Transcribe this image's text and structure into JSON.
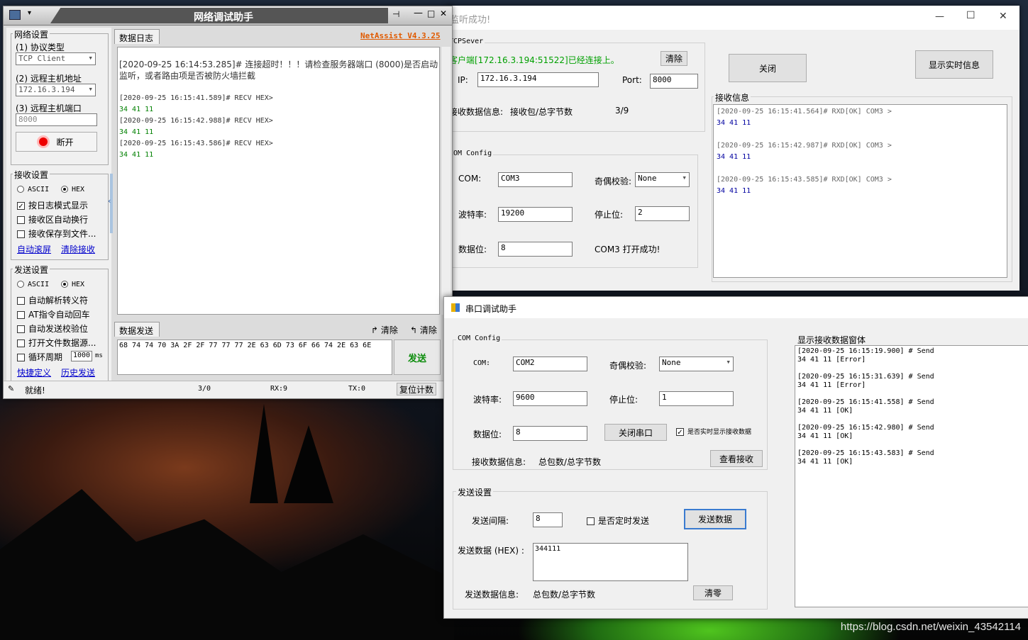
{
  "net": {
    "title": "网络调试助手",
    "settings_label": "网络设置",
    "protocol_label": "(1) 协议类型",
    "protocol_value": "TCP Client",
    "host_label": "(2) 远程主机地址",
    "host_value": "172.16.3.194",
    "port_label": "(3) 远程主机端口",
    "port_value": "8000",
    "disconnect_label": "断开",
    "recv_settings_label": "接收设置",
    "recv_ascii": "ASCII",
    "recv_hex": "HEX",
    "recv_opts": [
      "按日志模式显示",
      "接收区自动换行",
      "接收保存到文件..."
    ],
    "recv_links": [
      "自动滚屏",
      "清除接收"
    ],
    "send_settings_label": "发送设置",
    "send_ascii": "ASCII",
    "send_hex": "HEX",
    "send_opts": [
      "自动解析转义符",
      "AT指令自动回车",
      "自动发送校验位",
      "打开文件数据源...",
      "循环周期"
    ],
    "cycle_value": "1000",
    "cycle_unit": "ms",
    "send_links": [
      "快捷定义",
      "历史发送"
    ],
    "log_tab": "数据日志",
    "brand": "NetAssist V4.3.25",
    "log": [
      {
        "text": "[2020-09-25 16:14:53.285]# 连接超时！！！请检查服务器端口 (8000)是否启动",
        "color": "#333333"
      },
      {
        "text": "监听，或者路由项是否被防火墙拦截",
        "color": "#333333"
      },
      {
        "text": "",
        "color": "#333333"
      },
      {
        "text": "[2020-09-25 16:15:41.589]# RECV HEX>",
        "color": "#333333"
      },
      {
        "text": "34 41 11",
        "color": "#008000"
      },
      {
        "text": "[2020-09-25 16:15:42.988]# RECV HEX>",
        "color": "#333333"
      },
      {
        "text": "34 41 11",
        "color": "#008000"
      },
      {
        "text": "[2020-09-25 16:15:43.586]# RECV HEX>",
        "color": "#333333"
      },
      {
        "text": "34 41 11",
        "color": "#008000"
      }
    ],
    "send_tab": "数据发送",
    "clear1": "清除",
    "clear2": "清除",
    "send_data": "68 74 74 70 3A 2F 2F 77 77 77 2E 63 6D 73 6F 66 74 2E 63 6E",
    "send_btn": "发送",
    "status": "就绪!",
    "count": "3/0",
    "rx": "RX:9",
    "tx": "TX:0",
    "reset": "复位计数"
  },
  "server": {
    "title": "监听成功!",
    "group_tcp": "TCPSever",
    "client_msg": "客户端[172.16.3.194:51522]已经连接上。",
    "clear": "清除",
    "ip_label": "IP:",
    "ip_value": "172.16.3.194",
    "port_label": "Port:",
    "port_value": "8000",
    "recv_info_label": "接收数据信息:",
    "recv_info_desc": "接收包/总字节数",
    "recv_info_value": "3/9",
    "group_com": "COM Config",
    "com_label": "COM:",
    "com_value": "COM3",
    "parity_label": "奇偶校验:",
    "parity_value": "None",
    "baud_label": "波特率:",
    "baud_value": "19200",
    "stop_label": "停止位:",
    "stop_value": "2",
    "data_label": "数据位:",
    "data_value": "8",
    "open_msg": "COM3 打开成功!",
    "close_btn": "关闭",
    "realtime_btn": "显示实时信息",
    "recv_label": "接收信息",
    "recv_log": [
      {
        "text": "[2020-09-25 16:15:41.564]# RXD[OK] COM3 >",
        "color": "#666666"
      },
      {
        "text": "34 41 11",
        "color": "#0000a0"
      },
      {
        "text": "",
        "color": "#666666"
      },
      {
        "text": "[2020-09-25 16:15:42.987]# RXD[OK] COM3 >",
        "color": "#666666"
      },
      {
        "text": "34 41 11",
        "color": "#0000a0"
      },
      {
        "text": "",
        "color": "#666666"
      },
      {
        "text": "[2020-09-25 16:15:43.585]# RXD[OK] COM3 >",
        "color": "#666666"
      },
      {
        "text": "34 41 11",
        "color": "#0000a0"
      }
    ],
    "min": "—",
    "max": "☐",
    "close": "✕"
  },
  "serial": {
    "title": "串口调试助手",
    "group_com": "COM Config",
    "com_label": "COM:",
    "com_value": "COM2",
    "parity_label": "奇偶校验:",
    "parity_value": "None",
    "baud_label": "波特率:",
    "baud_value": "9600",
    "stop_label": "停止位:",
    "stop_value": "1",
    "data_label": "数据位:",
    "data_value": "8",
    "close_port_btn": "关闭串口",
    "realtime_cb": "是否实时显示接收数据",
    "recv_info_label": "接收数据信息:",
    "recv_info_desc": "总包数/总字节数",
    "view_recv_btn": "查看接收",
    "group_send": "发送设置",
    "interval_label": "发送间隔:",
    "interval_value": "8",
    "timer_cb": "是否定时发送",
    "send_btn": "发送数据",
    "send_hex_label": "发送数据 (HEX) :",
    "send_hex_value": "344111",
    "send_info_label": "发送数据信息:",
    "send_info_desc": "总包数/总字节数",
    "clear_btn": "清零",
    "display_label": "显示接收数据窗体",
    "display_log": [
      "[2020-09-25 16:15:19.900] # Send",
      "34 41 11 [Error]",
      "",
      "[2020-09-25 16:15:31.639] # Send",
      "34 41 11 [Error]",
      "",
      "[2020-09-25 16:15:41.558] # Send",
      "34 41 11 [OK]",
      "",
      "[2020-09-25 16:15:42.980] # Send",
      "34 41 11 [OK]",
      "",
      "[2020-09-25 16:15:43.583] # Send",
      "34 41 11 [OK]"
    ]
  },
  "watermark": "https://blog.csdn.net/weixin_43542114"
}
